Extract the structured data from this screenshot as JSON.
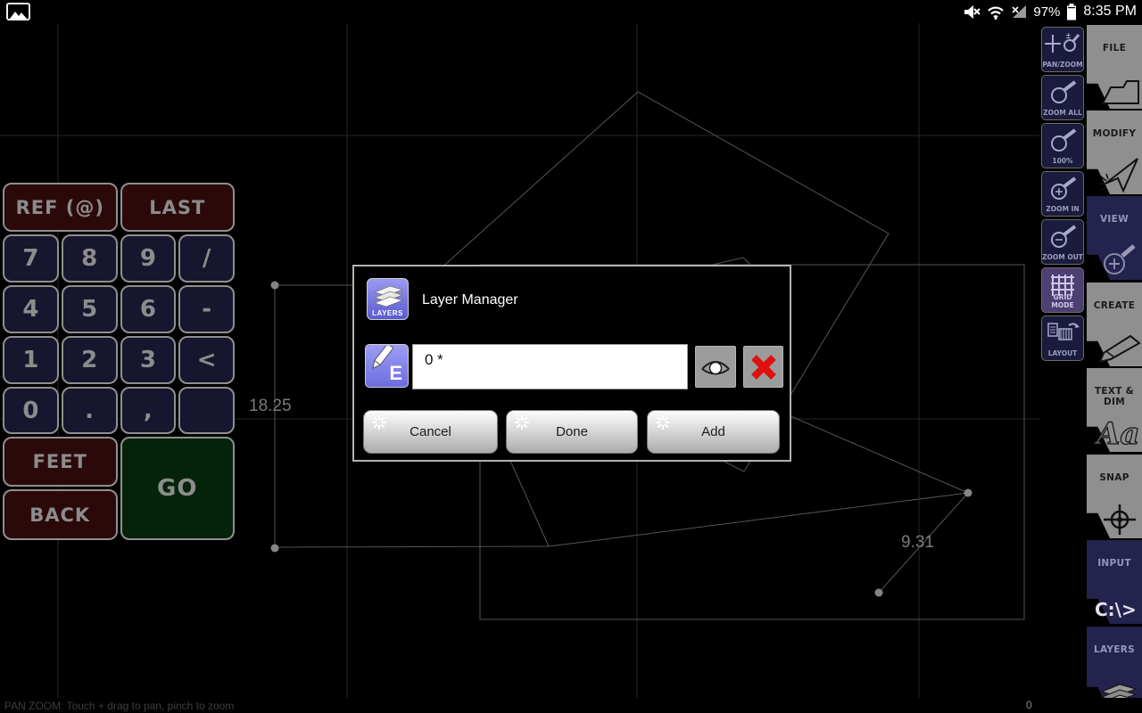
{
  "status_bar": {
    "time": "8:35 PM",
    "battery_percent": "97%",
    "icons": [
      "screenshot-icon",
      "mute-icon",
      "wifi-icon",
      "no-signal-icon",
      "battery-icon"
    ]
  },
  "canvas": {
    "dimension_labels": [
      {
        "text": "18.25"
      },
      {
        "text": "9.31"
      }
    ]
  },
  "keypad": {
    "top": [
      "REF (@)",
      "LAST"
    ],
    "keys": [
      [
        "7",
        "8",
        "9",
        "/"
      ],
      [
        "4",
        "5",
        "6",
        "-"
      ],
      [
        "1",
        "2",
        "3",
        "<"
      ],
      [
        "0",
        ".",
        ",",
        ""
      ]
    ],
    "feet": "FEET",
    "go": "GO",
    "back": "BACK"
  },
  "dialog": {
    "title": "Layer Manager",
    "app_icon_label": "LAYERS",
    "edit_icon_letter": "E",
    "layer_field": {
      "value": "0 *"
    },
    "buttons": {
      "cancel": "Cancel",
      "done": "Done",
      "add": "Add"
    }
  },
  "zoom_toolbar": {
    "items": [
      {
        "label": "PAN/ZOOM"
      },
      {
        "label": "ZOOM ALL"
      },
      {
        "label": "100%"
      },
      {
        "label": "ZOOM IN"
      },
      {
        "label": "ZOOM OUT"
      },
      {
        "label": "GRID MODE"
      },
      {
        "label": "LAYOUT"
      }
    ]
  },
  "main_toolbar": {
    "items": [
      {
        "label": "FILE"
      },
      {
        "label": "MODIFY"
      },
      {
        "label": "VIEW"
      },
      {
        "label": "CREATE"
      },
      {
        "label": "TEXT & DIM",
        "icon_text": "Aa"
      },
      {
        "label": "SNAP"
      },
      {
        "label": "INPUT",
        "icon_text": "C:\\>"
      },
      {
        "label": "LAYERS"
      }
    ]
  },
  "bottom_bar": {
    "hint": "PAN ZOOM: Touch + drag to pan, pinch to zoom",
    "counter": "0"
  },
  "colors": {
    "keypad_navy": "#16162e",
    "keypad_maroon": "#2b090b",
    "keypad_green": "#05230a",
    "toolbar_gray": "#8f8f8f",
    "toolbar_navy": "#23234d",
    "grid_mode_purple": "#4d3f72",
    "icon_purple": "#7b7bea",
    "delete_red": "#e01010"
  }
}
